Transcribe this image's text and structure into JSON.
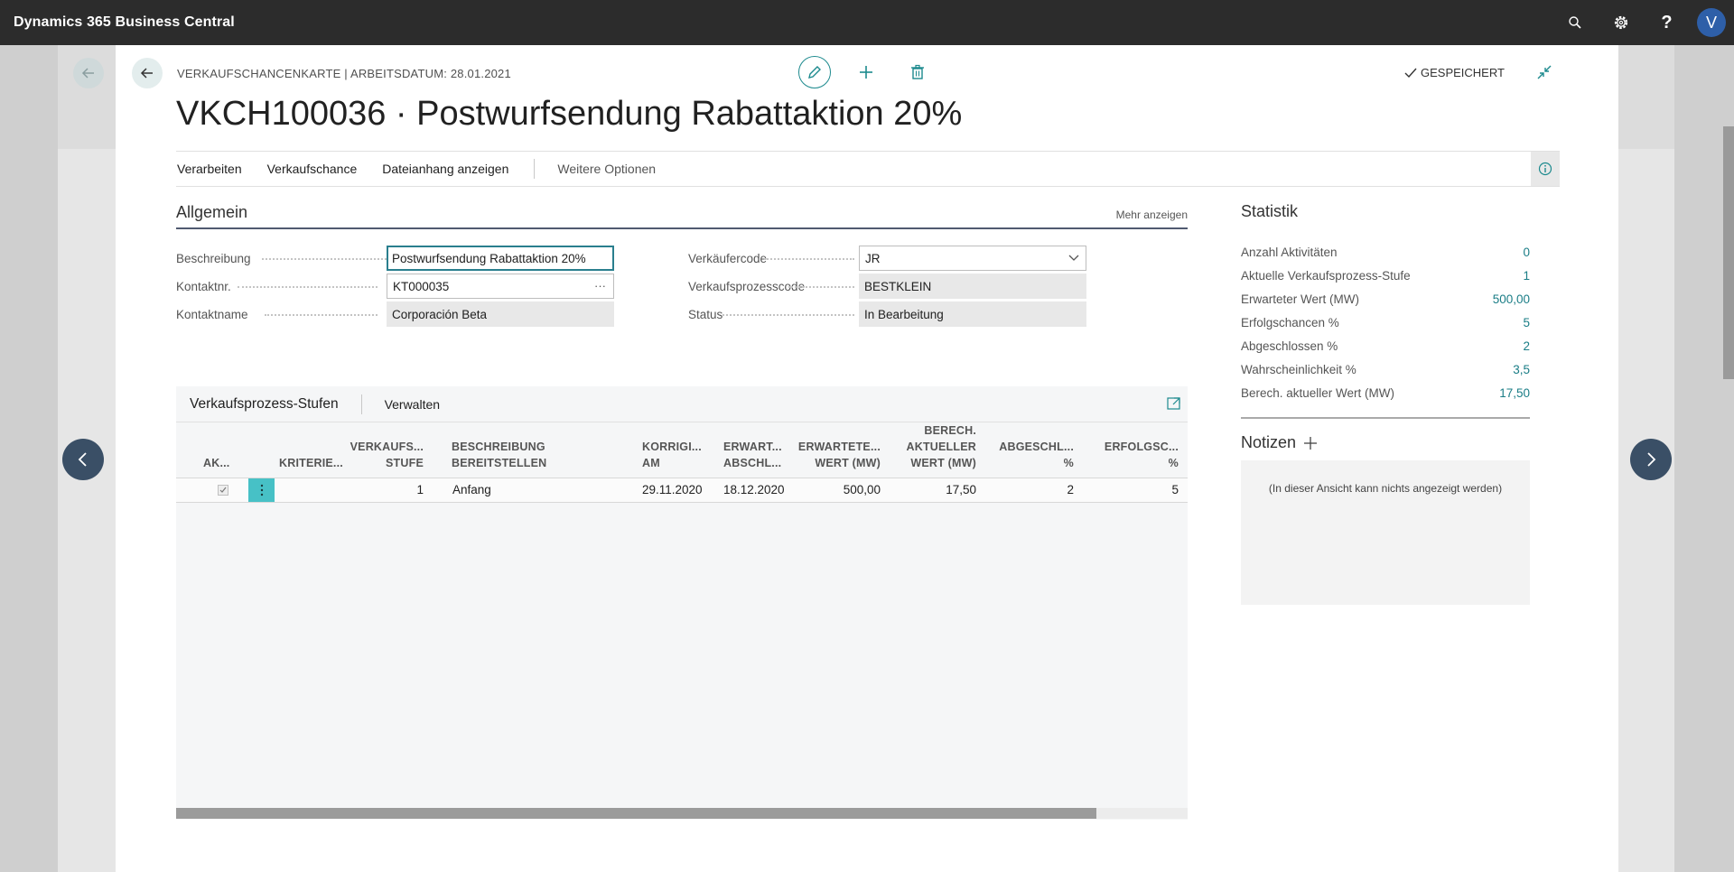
{
  "app": {
    "title": "Dynamics 365 Business Central",
    "user_initial": "V"
  },
  "header": {
    "caption": "VERKAUFSCHANCENKARTE | ARBEITSDATUM: 28.01.2021",
    "title": "VKCH100036 · Postwurfsendung Rabattaktion 20%",
    "saved": "GESPEICHERT"
  },
  "actions": {
    "items": [
      "Verarbeiten",
      "Verkaufschance",
      "Dateianhang anzeigen"
    ],
    "more": "Weitere Optionen"
  },
  "general": {
    "title": "Allgemein",
    "show_more": "Mehr anzeigen",
    "fields": {
      "beschreibung": {
        "label": "Beschreibung",
        "value": "Postwurfsendung Rabattaktion 20%"
      },
      "kontaktnr": {
        "label": "Kontaktnr.",
        "value": "KT000035"
      },
      "kontaktname": {
        "label": "Kontaktname",
        "value": "Corporación Beta"
      },
      "verkaeufercode": {
        "label": "Verkäufercode",
        "value": "JR"
      },
      "verkaufsprozesscode": {
        "label": "Verkaufsprozesscode",
        "value": "BESTKLEIN"
      },
      "status": {
        "label": "Status",
        "value": "In Bearbeitung"
      }
    }
  },
  "subpage": {
    "title": "Verkaufsprozess-Stufen",
    "manage": "Verwalten",
    "columns": {
      "ak": "AK...",
      "kriterien": "KRITERIE...",
      "stufe1": "VERKAUFS...",
      "stufe2": "STUFE",
      "beschr1": "BESCHREIBUNG",
      "beschr2": "BEREITSTELLEN",
      "korr1": "KORRIGI...",
      "korr2": "AM",
      "erw1": "ERWART...",
      "erw2": "ABSCHL...",
      "wert1": "ERWARTETE...",
      "wert2": "WERT (MW)",
      "berech1": "BERECH.",
      "berech2": "AKTUELLER",
      "berech3": "WERT (MW)",
      "abg1": "ABGESCHL...",
      "abg2": "%",
      "erf1": "ERFOLGSC...",
      "erf2": "%"
    },
    "row": {
      "stufe": "1",
      "beschreibung": "Anfang",
      "korrigiert_am": "29.11.2020",
      "erw_abschluss": "18.12.2020",
      "erw_wert": "500,00",
      "berech_wert": "17,50",
      "abgeschlossen": "2",
      "erfolgschancen": "5"
    }
  },
  "statistik": {
    "title": "Statistik",
    "rows": [
      {
        "label": "Anzahl Aktivitäten",
        "value": "0"
      },
      {
        "label": "Aktuelle Verkaufsprozess-Stufe",
        "value": "1"
      },
      {
        "label": "Erwarteter Wert (MW)",
        "value": "500,00"
      },
      {
        "label": "Erfolgschancen %",
        "value": "5"
      },
      {
        "label": "Abgeschlossen %",
        "value": "2"
      },
      {
        "label": "Wahrscheinlichkeit %",
        "value": "3,5"
      },
      {
        "label": "Berech. aktueller Wert (MW)",
        "value": "17,50"
      }
    ]
  },
  "notizen": {
    "title": "Notizen",
    "empty": "(In dieser Ansicht kann nichts angezeigt werden)"
  },
  "icons": {
    "search": "search-icon",
    "settings": "gear-icon",
    "help": "help-icon",
    "edit": "pencil-icon",
    "new": "plus-icon",
    "delete": "trash-icon",
    "saved": "checkmark-icon",
    "collapse": "collapse-icon",
    "info": "info-icon",
    "expand": "expand-icon",
    "prev": "chevron-left-icon",
    "next": "chevron-right-icon"
  },
  "colors": {
    "accent": "#1d8a8e",
    "appbar": "#2c2c2c",
    "nav": "#3a4f66"
  }
}
